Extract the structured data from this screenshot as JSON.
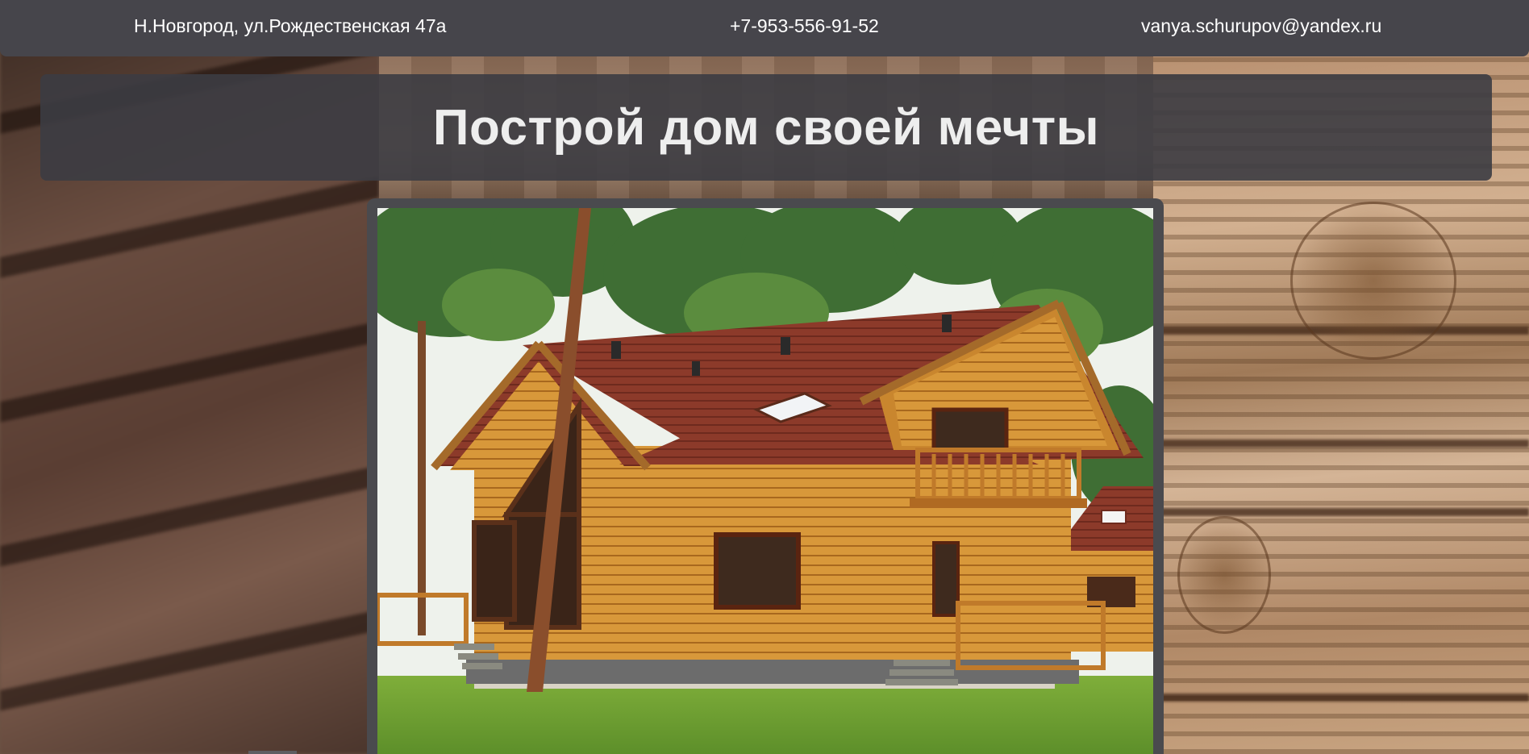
{
  "contacts": {
    "address": "Н.Новгород, ул.Рождественская 47а",
    "phone": "+7-953-556-91-52",
    "email": "vanya.schurupov@yandex.ru"
  },
  "hero": {
    "title": "Построй дом своей мечты"
  },
  "photo": {
    "subject": "wooden-log-house"
  },
  "colors": {
    "topbar": "#46454b",
    "hero_panel": "#3c3c42",
    "title_text": "#eeeeee",
    "roof": "#8a3a2a",
    "timber": "#d89a3c"
  }
}
